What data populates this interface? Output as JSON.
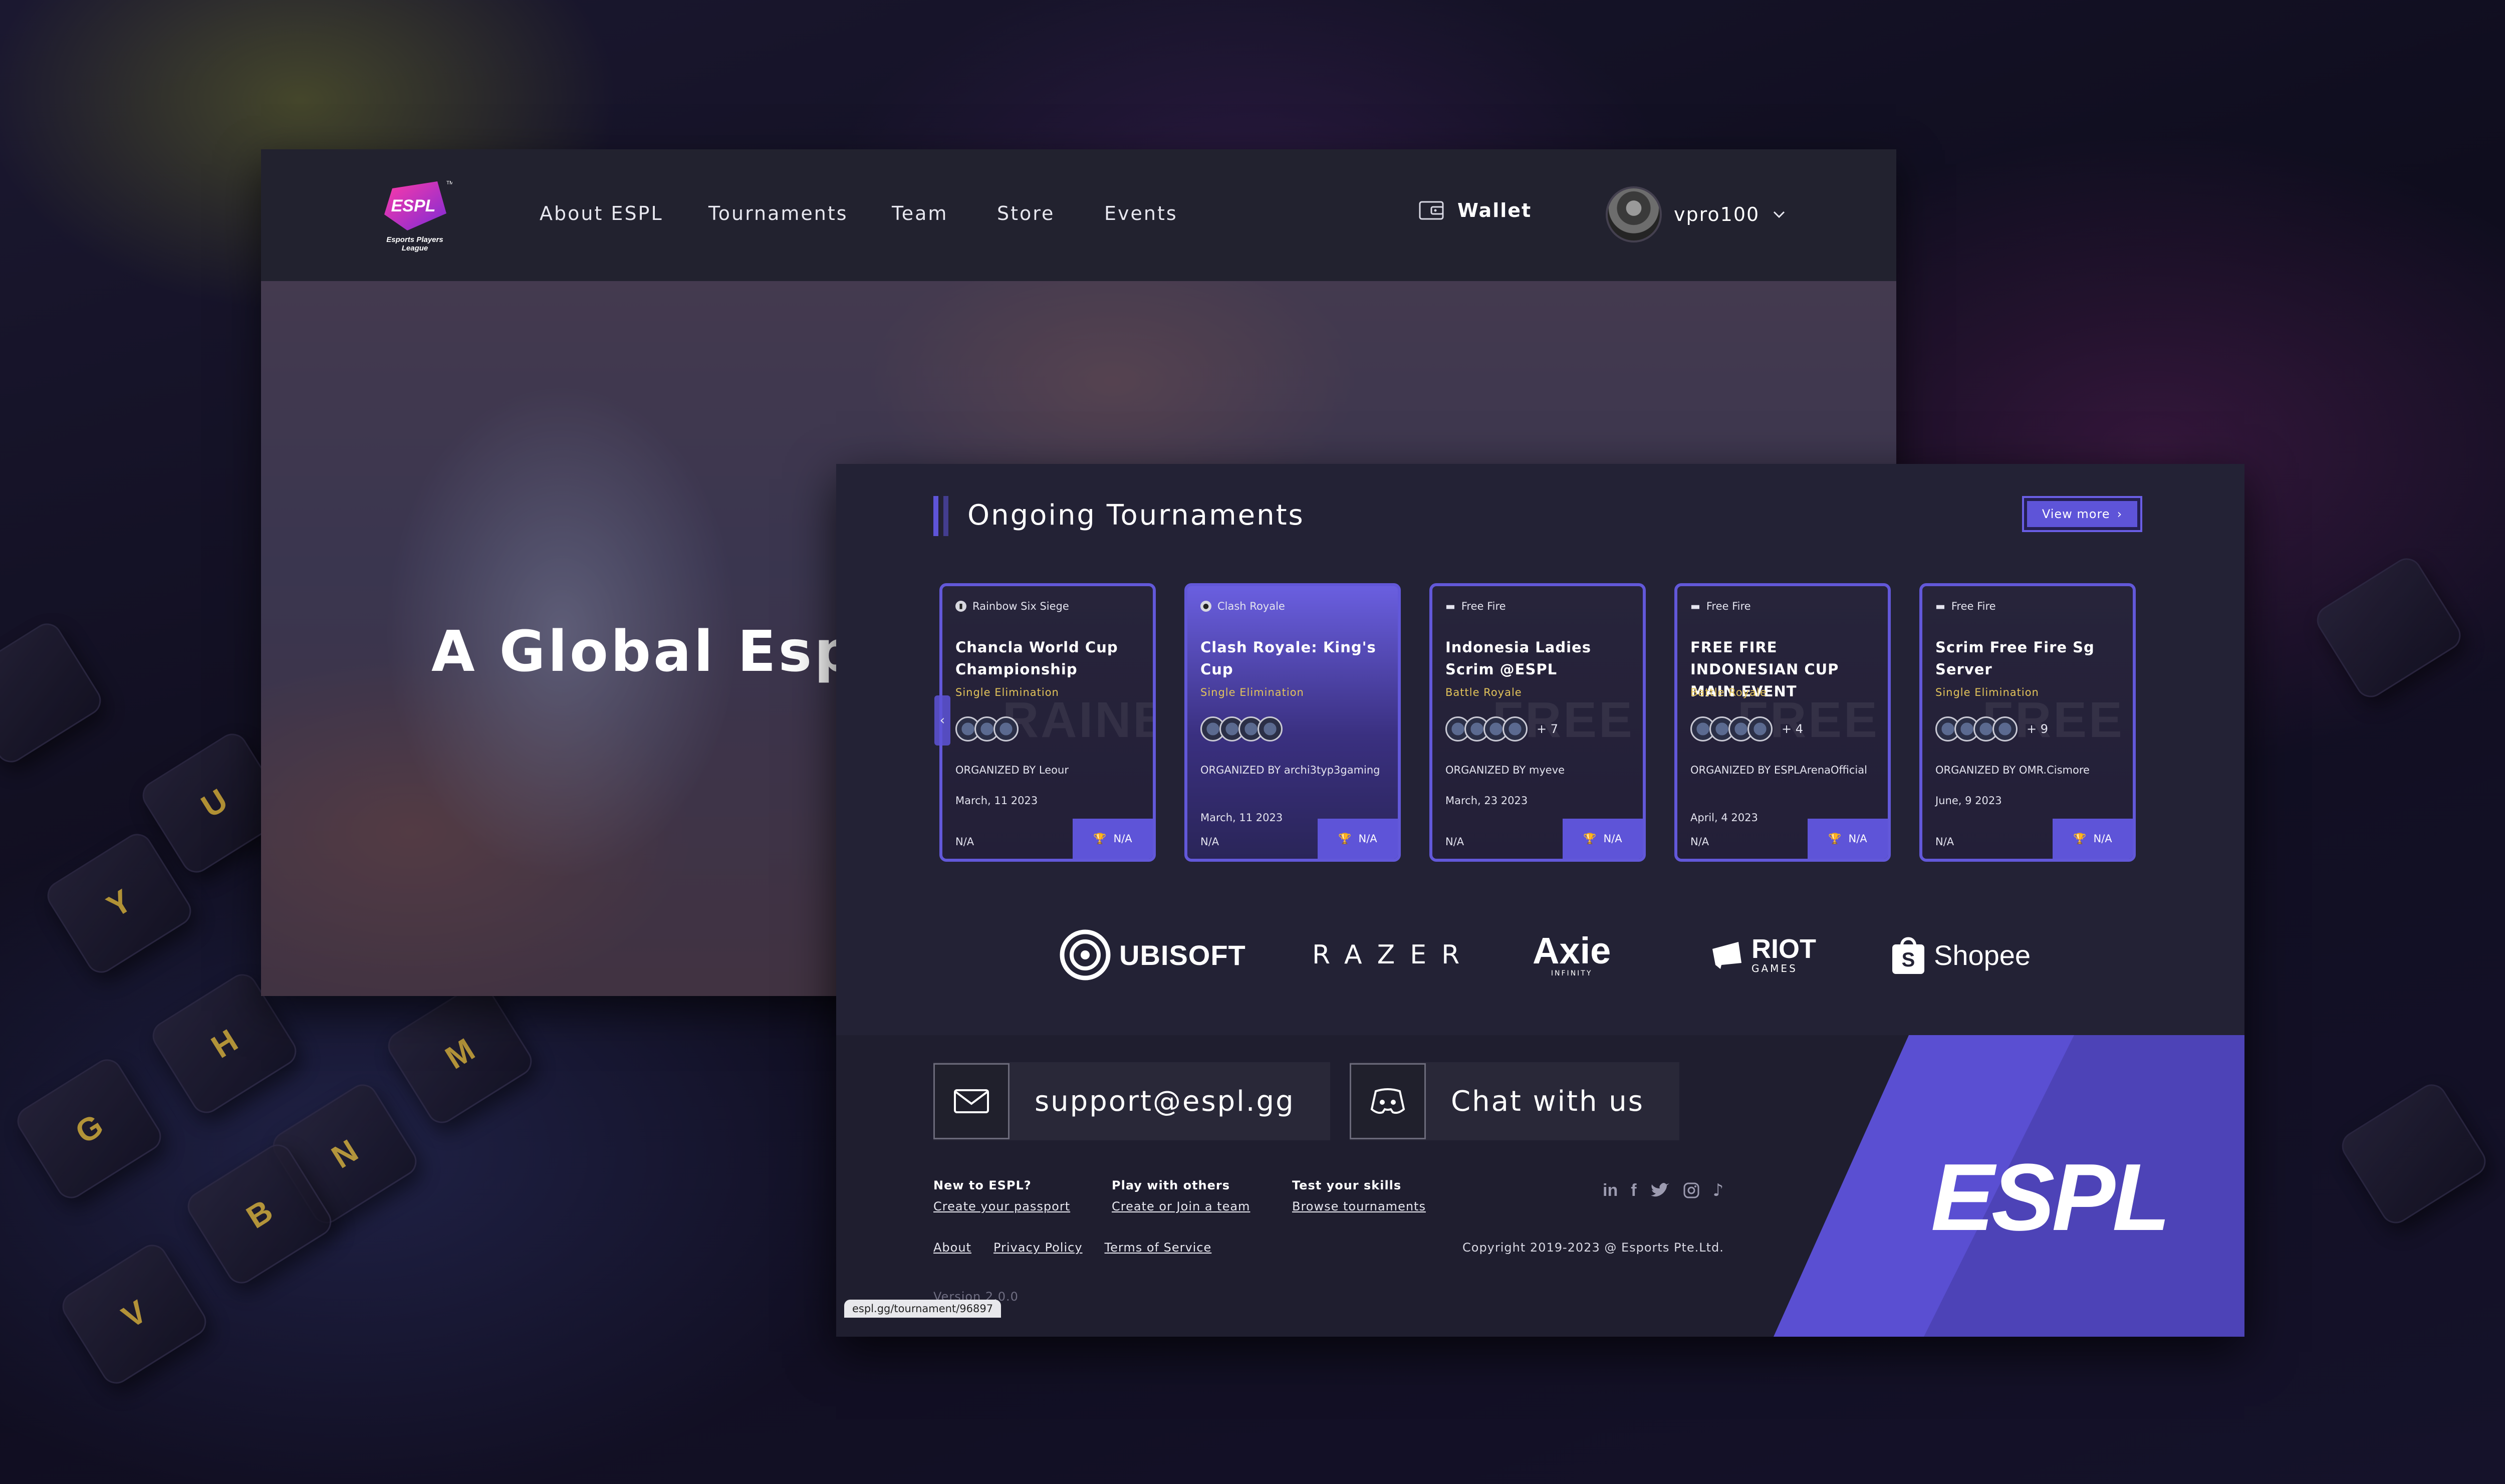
{
  "brand": {
    "logo_text": "ESPL",
    "logo_subtitle": "Esports Players League",
    "trademark": "TM"
  },
  "nav": {
    "items": [
      "About ESPL",
      "Tournaments",
      "Team",
      "Store",
      "Events"
    ],
    "wallet_label": "Wallet",
    "username": "vpro100"
  },
  "hero": {
    "title": "A Global Esport"
  },
  "ongoing": {
    "title": "Ongoing Tournaments",
    "view_more": "View more",
    "cards": [
      {
        "game": "Rainbow Six Siege",
        "title": "Chancla World Cup Championship",
        "format": "Single Elimination",
        "more": "",
        "organizer": "ORGANIZED BY Leour",
        "date": "March, 11 2023",
        "entry": "N/A",
        "prize": "N/A",
        "watermark": "RAINBOW SIEGE"
      },
      {
        "game": "Clash Royale",
        "title": "Clash Royale: King's Cup",
        "format": "Single Elimination",
        "more": "",
        "organizer": "ORGANIZED BY archi3typ3gaming",
        "date": "March, 11 2023",
        "entry": "N/A",
        "prize": "N/A",
        "watermark": ""
      },
      {
        "game": "Free Fire",
        "title": "Indonesia Ladies Scrim @ESPL",
        "format": "Battle Royale",
        "more": "+ 7",
        "organizer": "ORGANIZED BY myeve",
        "date": "March, 23 2023",
        "entry": "N/A",
        "prize": "N/A",
        "watermark": "FREE FIRE"
      },
      {
        "game": "Free Fire",
        "title": "FREE FIRE INDONESIAN CUP MAIN EVENT",
        "format": "Battle Royale",
        "more": "+ 4",
        "organizer": "ORGANIZED BY ESPLArenaOfficial",
        "date": "April, 4 2023",
        "entry": "N/A",
        "prize": "N/A",
        "watermark": "FREE FIRE"
      },
      {
        "game": "Free Fire",
        "title": "Scrim Free Fire Sg Server",
        "format": "Single Elimination",
        "more": "+ 9",
        "organizer": "ORGANIZED BY OMR.Cismore",
        "date": "June, 9 2023",
        "entry": "N/A",
        "prize": "N/A",
        "watermark": "FREE FIRE"
      }
    ]
  },
  "partners": [
    {
      "name": "UBISOFT"
    },
    {
      "name": "RAZER"
    },
    {
      "name": "Axie",
      "sub": "INFINITY"
    },
    {
      "name": "RIOT",
      "sub": "GAMES"
    },
    {
      "name": "Shopee"
    }
  ],
  "footer": {
    "email": "support@espl.gg",
    "chat": "Chat with us",
    "cols": [
      {
        "head": "New to ESPL?",
        "link": "Create your passport"
      },
      {
        "head": "Play with others",
        "link": "Create or Join a team"
      },
      {
        "head": "Test your skills",
        "link": "Browse tournaments"
      }
    ],
    "links": [
      "About",
      "Privacy Policy",
      "Terms of Service"
    ],
    "copyright": "Copyright 2019-2023 @ Esports Pte.Ltd.",
    "version": "Version 2.0.0",
    "big_logo": "ESPL",
    "social": [
      "linkedin-icon",
      "facebook-icon",
      "twitter-icon",
      "instagram-icon",
      "tiktok-icon"
    ]
  },
  "status_url": "espl.gg/tournament/96897",
  "colors": {
    "accent": "#5e54d8",
    "gold": "#e3c45a",
    "panel": "#232235"
  }
}
